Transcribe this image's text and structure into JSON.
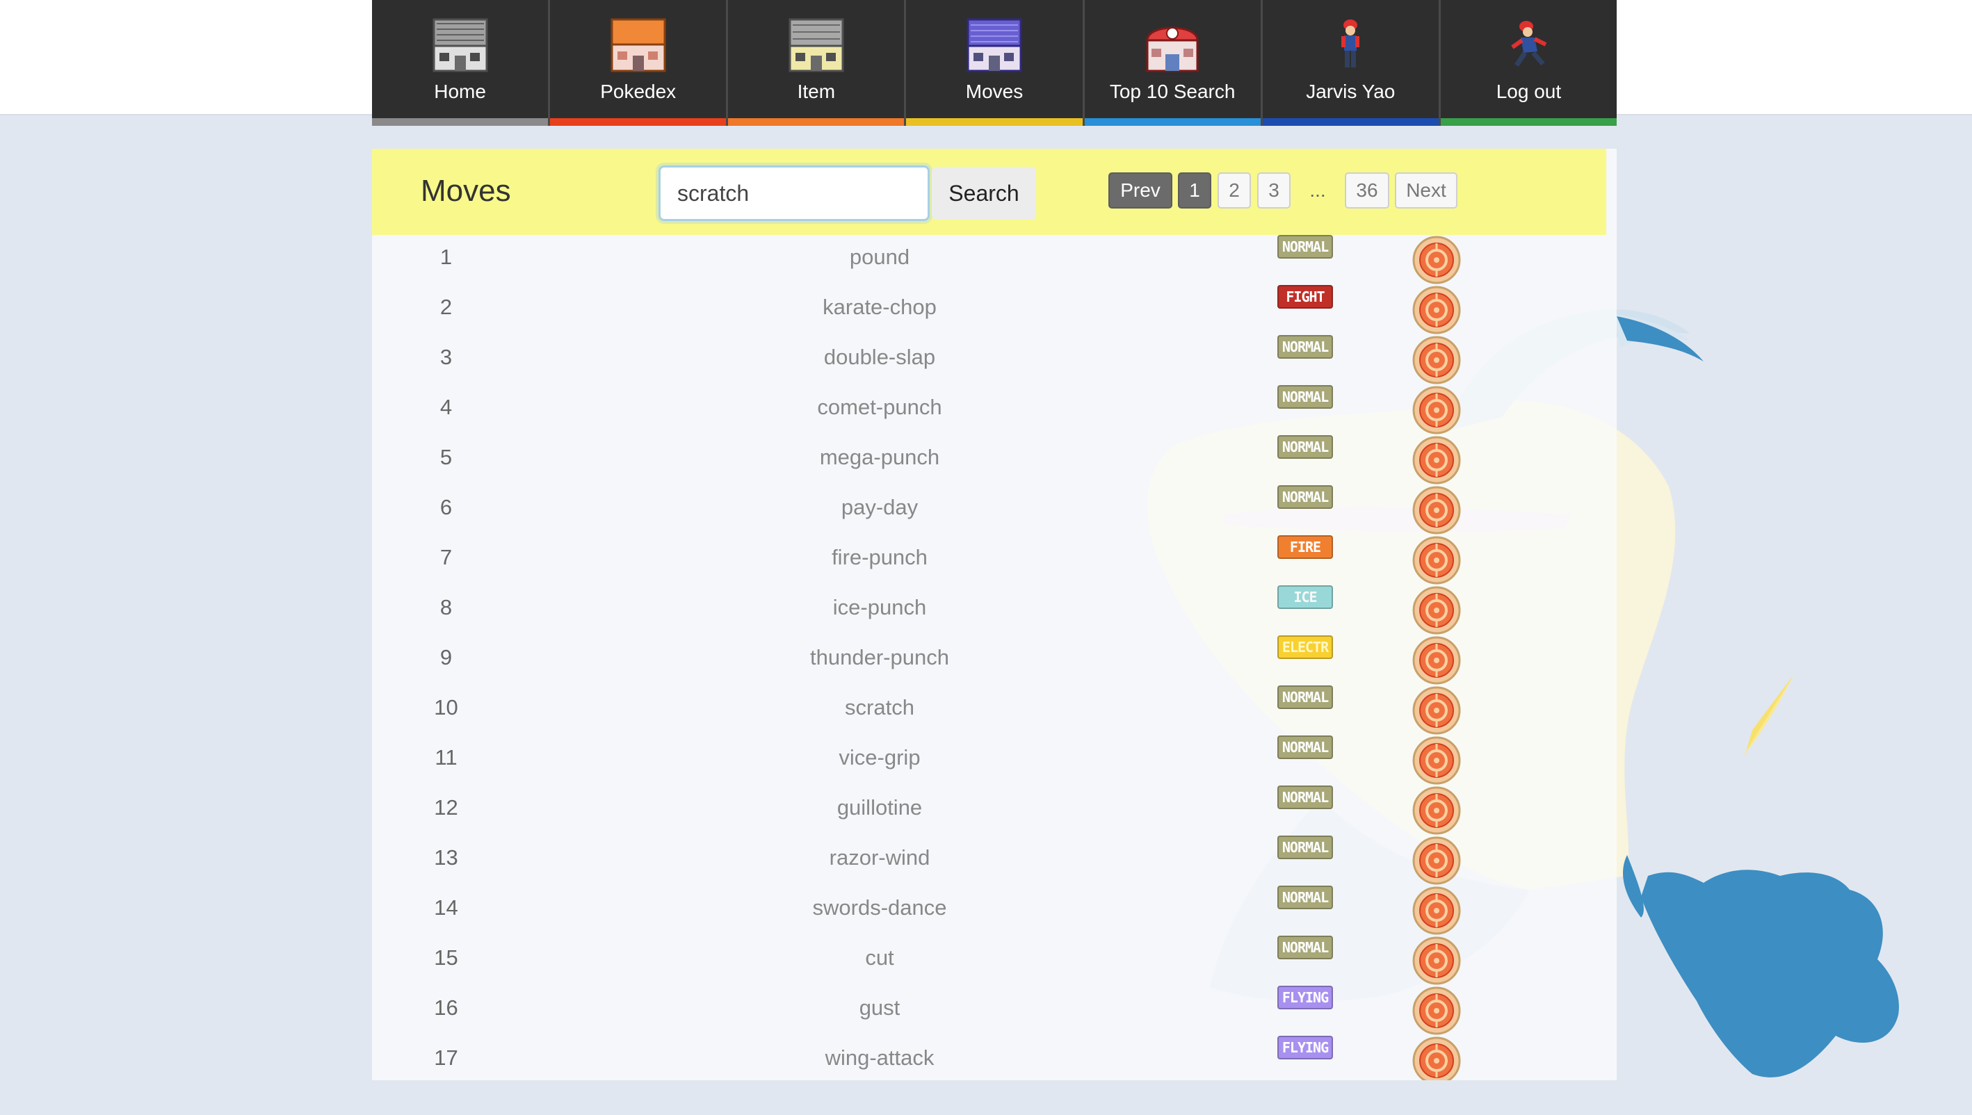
{
  "nav": {
    "items": [
      {
        "label": "Home",
        "color": "#8a8a8a",
        "icon": "home-building-icon"
      },
      {
        "label": "Pokedex",
        "color": "#e8401c",
        "icon": "pokedex-building-icon"
      },
      {
        "label": "Item",
        "color": "#f07828",
        "icon": "mart-building-icon"
      },
      {
        "label": "Moves",
        "color": "#e8c020",
        "icon": "moves-building-icon"
      },
      {
        "label": "Top 10 Search",
        "color": "#2890d8",
        "icon": "pokecenter-icon"
      },
      {
        "label": "Jarvis Yao",
        "color": "#1c4cb0",
        "icon": "trainer-icon"
      },
      {
        "label": "Log out",
        "color": "#38a048",
        "icon": "running-trainer-icon"
      }
    ]
  },
  "panel": {
    "title": "Moves",
    "search": {
      "value": "scratch",
      "button_label": "Search"
    },
    "pager": {
      "prev": "Prev",
      "pages": [
        "1",
        "2",
        "3"
      ],
      "ellipsis": "...",
      "last": "36",
      "next": "Next",
      "current": "1"
    }
  },
  "moves": [
    {
      "id": "1",
      "name": "pound",
      "type": "NORMAL"
    },
    {
      "id": "2",
      "name": "karate-chop",
      "type": "FIGHT"
    },
    {
      "id": "3",
      "name": "double-slap",
      "type": "NORMAL"
    },
    {
      "id": "4",
      "name": "comet-punch",
      "type": "NORMAL"
    },
    {
      "id": "5",
      "name": "mega-punch",
      "type": "NORMAL"
    },
    {
      "id": "6",
      "name": "pay-day",
      "type": "NORMAL"
    },
    {
      "id": "7",
      "name": "fire-punch",
      "type": "FIRE"
    },
    {
      "id": "8",
      "name": "ice-punch",
      "type": "ICE"
    },
    {
      "id": "9",
      "name": "thunder-punch",
      "type": "ELECTR"
    },
    {
      "id": "10",
      "name": "scratch",
      "type": "NORMAL"
    },
    {
      "id": "11",
      "name": "vice-grip",
      "type": "NORMAL"
    },
    {
      "id": "12",
      "name": "guillotine",
      "type": "NORMAL"
    },
    {
      "id": "13",
      "name": "razor-wind",
      "type": "NORMAL"
    },
    {
      "id": "14",
      "name": "swords-dance",
      "type": "NORMAL"
    },
    {
      "id": "15",
      "name": "cut",
      "type": "NORMAL"
    },
    {
      "id": "16",
      "name": "gust",
      "type": "FLYING"
    },
    {
      "id": "17",
      "name": "wing-attack",
      "type": "FLYING"
    }
  ],
  "type_colors": {
    "NORMAL": "#a8a878",
    "FIGHT": "#c03028",
    "FIRE": "#f08030",
    "ICE": "#98d8d8",
    "ELECTR": "#f8d030",
    "FLYING": "#a890f0"
  },
  "category_icon": "physical-category-icon"
}
